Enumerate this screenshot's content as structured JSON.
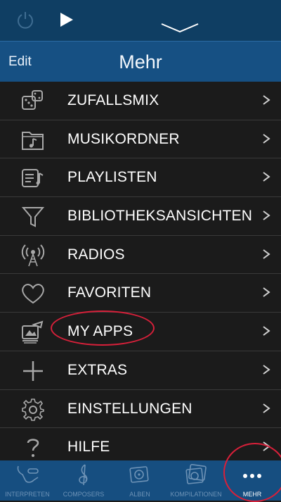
{
  "header": {
    "edit_label": "Edit",
    "title": "Mehr"
  },
  "menu": [
    {
      "label": "ZUFALLSMIX",
      "icon": "dice-icon"
    },
    {
      "label": "MUSIKORDNER",
      "icon": "music-folder-icon"
    },
    {
      "label": "PLAYLISTEN",
      "icon": "playlist-icon"
    },
    {
      "label": "BIBLIOTHEKSANSICHTEN",
      "icon": "filter-icon"
    },
    {
      "label": "RADIOS",
      "icon": "radio-tower-icon"
    },
    {
      "label": "FAVORITEN",
      "icon": "heart-icon"
    },
    {
      "label": "MY APPS",
      "icon": "apps-icon",
      "highlighted": true
    },
    {
      "label": "EXTRAS",
      "icon": "plus-icon"
    },
    {
      "label": "EINSTELLUNGEN",
      "icon": "gear-icon"
    },
    {
      "label": "HILFE",
      "icon": "help-icon"
    }
  ],
  "tabs": [
    {
      "label": "INTERPRETEN",
      "icon": "artist-icon"
    },
    {
      "label": "COMPOSERS",
      "icon": "treble-clef-icon"
    },
    {
      "label": "ALBEN",
      "icon": "album-icon"
    },
    {
      "label": "KOMPILATIONEN",
      "icon": "compilation-icon"
    },
    {
      "label": "MEHR",
      "icon": "more-dots-icon",
      "active": true
    }
  ],
  "colors": {
    "accent": "#165083",
    "topbar": "#0f3e63",
    "annotation": "#d8203a",
    "inactive_tab": "#6e93b6"
  }
}
